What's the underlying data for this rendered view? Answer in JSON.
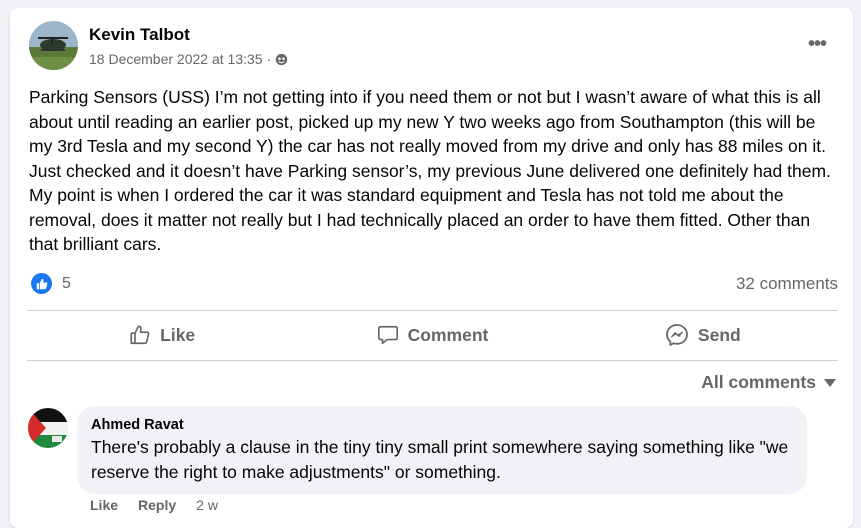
{
  "post": {
    "author": "Kevin Talbot",
    "timestamp": "18 December 2022 at 13:35",
    "meta_separator": "·",
    "audience_icon": "globe-icon",
    "more_icon": "more-options-icon",
    "more_label": "•••",
    "text": "Parking Sensors (USS) I’m not getting into if you need them or not but I wasn’t aware of what this is all about until reading an earlier post, picked up my new Y two weeks ago from Southampton (this will be my 3rd Tesla and my second Y) the car has not really moved from my drive and only has 88 miles on it. Just checked and it doesn’t have Parking sensor’s, my previous June delivered one definitely had them. My point is when I ordered the car it was standard equipment and Tesla has not told me about the removal, does it matter not really but I had technically placed an order to have them fitted. Other than that brilliant cars."
  },
  "stats": {
    "reaction_icon": "like-reaction-icon",
    "reaction_count": "5",
    "comments": "32 comments"
  },
  "actions": {
    "like": "Like",
    "comment": "Comment",
    "send": "Send"
  },
  "filter": {
    "label": "All comments",
    "icon": "caret-down-icon"
  },
  "comments": [
    {
      "author": "Ahmed Ravat",
      "text": "There's probably a clause in the tiny tiny small print somewhere saying something like \"we reserve the right to make adjustments\" or something.",
      "like_label": "Like",
      "reply_label": "Reply",
      "age": "2 w"
    }
  ],
  "colors": {
    "brand_blue": "#1877f2",
    "secondary_text": "#65676b",
    "bubble_bg": "#f0f2f5"
  }
}
